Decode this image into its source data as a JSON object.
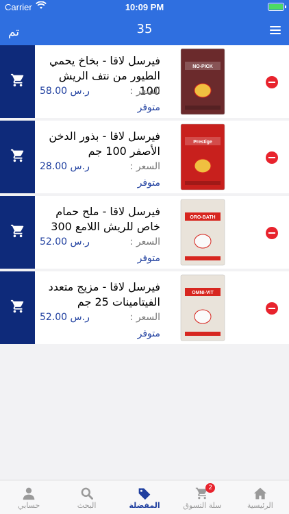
{
  "status": {
    "carrier": "Carrier",
    "time": "10:09 PM"
  },
  "header": {
    "done_label": "تم",
    "count": "35"
  },
  "items": [
    {
      "name": "فيرسل لاقا - بخاخ يحمي الطيور من نتف الريش 100",
      "price_label": "السعر :",
      "price": "ر.س 58.00",
      "status": "متوفر",
      "image": "no-pick-spray-box",
      "box_color": "#6b2a2c",
      "box_text": "NO-PICK"
    },
    {
      "name": "فيرسل لاقا - بذور الدخن الأصفر 100 جم",
      "price_label": "السعر :",
      "price": "ر.س 28.00",
      "status": "متوفر",
      "image": "prestige-millet-pack",
      "box_color": "#c8201d",
      "box_text": "Prestige"
    },
    {
      "name": "فيرسل لاقا - ملح حمام خاص للريش اللامع 300",
      "price_label": "السعر :",
      "price": "ر.س 52.00",
      "status": "متوفر",
      "image": "oro-bath-box",
      "box_color": "#e9e3da",
      "box_text": "ORO-BATH"
    },
    {
      "name": "فيرسل لاقا - مزيج متعدد الفيتامينات 25 جم",
      "price_label": "السعر :",
      "price": "ر.س 52.00",
      "status": "متوفر",
      "image": "omni-vit-box",
      "box_color": "#e9e3da",
      "box_text": "OMNI-VIT"
    }
  ],
  "tabs": [
    {
      "label": "حسابي",
      "icon": "person-icon",
      "active": false
    },
    {
      "label": "البحث",
      "icon": "search-icon",
      "active": false
    },
    {
      "label": "المفضلة",
      "icon": "tag-icon",
      "active": true
    },
    {
      "label": "سلة التسوق",
      "icon": "cart-icon",
      "active": false,
      "badge": "2"
    },
    {
      "label": "الرئيسية",
      "icon": "home-icon",
      "active": false
    }
  ],
  "colors": {
    "header_bg": "#2f6fe0",
    "cart_col": "#0e2a7a",
    "accent": "#1f3f9f",
    "delete": "#e8232d"
  }
}
